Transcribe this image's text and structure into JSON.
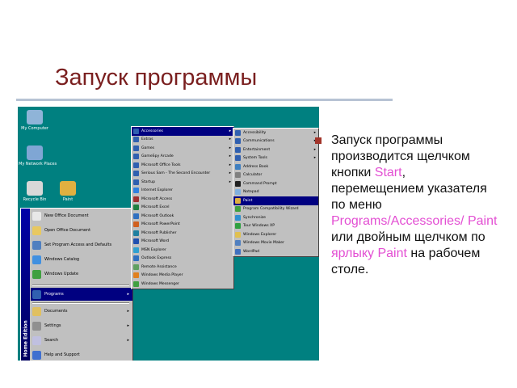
{
  "slide": {
    "title": "Запуск программы",
    "bullet_parts": [
      {
        "text": "Запуск программы производится щелчком кнопки ",
        "accent": false
      },
      {
        "text": "Start",
        "accent": true
      },
      {
        "text": ", перемещением указателя по меню ",
        "accent": false
      },
      {
        "text": "Programs/Accessories/ Paint",
        "accent": true
      },
      {
        "text": " или двойным щелчком по ",
        "accent": false
      },
      {
        "text": "ярлыку Paint",
        "accent": true
      },
      {
        "text": " на рабочем столе.",
        "accent": false
      }
    ],
    "colors": {
      "title": "#7a1f1f",
      "accent": "#e34fd3",
      "bullet": "#a2342a",
      "rule": "#b7c3d4"
    }
  },
  "screenshot": {
    "desktop_icons": [
      {
        "label": "My Computer",
        "icon": "computer-icon",
        "color": "#8fb4d8"
      },
      {
        "label": "My Network Places",
        "icon": "network-icon",
        "color": "#7fa6d4"
      },
      {
        "label": "Recycle Bin",
        "icon": "recycle-bin-icon",
        "color": "#d8d8d8"
      },
      {
        "label": "Paint",
        "icon": "paint-icon",
        "color": "#e0b040"
      }
    ],
    "start_menu": {
      "band_text": "Home Edition",
      "items": [
        {
          "label": "New Office Document",
          "arrow": false,
          "selected": false,
          "color": "#e8e8e8"
        },
        {
          "label": "Open Office Document",
          "arrow": false,
          "selected": false,
          "color": "#e8c860"
        },
        {
          "label": "Set Program Access and Defaults",
          "arrow": false,
          "selected": false,
          "color": "#5080c0"
        },
        {
          "label": "Windows Catalog",
          "arrow": false,
          "selected": false,
          "color": "#4090e0"
        },
        {
          "label": "Windows Update",
          "arrow": false,
          "selected": false,
          "color": "#40a040"
        },
        {
          "label": "Programs",
          "arrow": true,
          "selected": true,
          "color": "#3060b0"
        },
        {
          "label": "Documents",
          "arrow": true,
          "selected": false,
          "color": "#e0c060"
        },
        {
          "label": "Settings",
          "arrow": true,
          "selected": false,
          "color": "#909090"
        },
        {
          "label": "Search",
          "arrow": true,
          "selected": false,
          "color": "#c0c0e0"
        },
        {
          "label": "Help and Support",
          "arrow": false,
          "selected": false,
          "color": "#4070d0"
        }
      ]
    },
    "programs_menu": [
      {
        "label": "Accessories",
        "arrow": true,
        "selected": true,
        "color": "#3060b0"
      },
      {
        "label": "Extras",
        "arrow": true,
        "selected": false,
        "color": "#3060b0"
      },
      {
        "label": "Games",
        "arrow": true,
        "selected": false,
        "color": "#3060b0"
      },
      {
        "label": "GameSpy Arcade",
        "arrow": true,
        "selected": false,
        "color": "#3060b0"
      },
      {
        "label": "Microsoft Office Tools",
        "arrow": true,
        "selected": false,
        "color": "#3060b0"
      },
      {
        "label": "Serious Sam - The Second Encounter",
        "arrow": true,
        "selected": false,
        "color": "#3060b0"
      },
      {
        "label": "Startup",
        "arrow": true,
        "selected": false,
        "color": "#3060b0"
      },
      {
        "label": "Internet Explorer",
        "arrow": false,
        "selected": false,
        "color": "#3080e0"
      },
      {
        "label": "Microsoft Access",
        "arrow": false,
        "selected": false,
        "color": "#a03030"
      },
      {
        "label": "Microsoft Excel",
        "arrow": false,
        "selected": false,
        "color": "#208040"
      },
      {
        "label": "Microsoft Outlook",
        "arrow": false,
        "selected": false,
        "color": "#3070c0"
      },
      {
        "label": "Microsoft PowerPoint",
        "arrow": false,
        "selected": false,
        "color": "#d06020"
      },
      {
        "label": "Microsoft Publisher",
        "arrow": false,
        "selected": false,
        "color": "#2080a0"
      },
      {
        "label": "Microsoft Word",
        "arrow": false,
        "selected": false,
        "color": "#2050b0"
      },
      {
        "label": "MSN Explorer",
        "arrow": false,
        "selected": false,
        "color": "#30a0d0"
      },
      {
        "label": "Outlook Express",
        "arrow": false,
        "selected": false,
        "color": "#3070c0"
      },
      {
        "label": "Remote Assistance",
        "arrow": false,
        "selected": false,
        "color": "#60a060"
      },
      {
        "label": "Windows Media Player",
        "arrow": false,
        "selected": false,
        "color": "#e08020"
      },
      {
        "label": "Windows Messenger",
        "arrow": false,
        "selected": false,
        "color": "#40a040"
      }
    ],
    "accessories_menu": [
      {
        "label": "Accessibility",
        "arrow": true,
        "selected": false,
        "color": "#3060b0"
      },
      {
        "label": "Communications",
        "arrow": true,
        "selected": false,
        "color": "#3060b0"
      },
      {
        "label": "Entertainment",
        "arrow": true,
        "selected": false,
        "color": "#3060b0"
      },
      {
        "label": "System Tools",
        "arrow": true,
        "selected": false,
        "color": "#3060b0"
      },
      {
        "label": "Address Book",
        "arrow": false,
        "selected": false,
        "color": "#4080c0"
      },
      {
        "label": "Calculator",
        "arrow": false,
        "selected": false,
        "color": "#808080"
      },
      {
        "label": "Command Prompt",
        "arrow": false,
        "selected": false,
        "color": "#202020"
      },
      {
        "label": "Notepad",
        "arrow": false,
        "selected": false,
        "color": "#80b0e0"
      },
      {
        "label": "Paint",
        "arrow": false,
        "selected": true,
        "color": "#e0b040"
      },
      {
        "label": "Program Compatibility Wizard",
        "arrow": false,
        "selected": false,
        "color": "#40a040"
      },
      {
        "label": "Synchronize",
        "arrow": false,
        "selected": false,
        "color": "#3090d0"
      },
      {
        "label": "Tour Windows XP",
        "arrow": false,
        "selected": false,
        "color": "#30a040"
      },
      {
        "label": "Windows Explorer",
        "arrow": false,
        "selected": false,
        "color": "#e0c050"
      },
      {
        "label": "Windows Movie Maker",
        "arrow": false,
        "selected": false,
        "color": "#5080c0"
      },
      {
        "label": "WordPad",
        "arrow": false,
        "selected": false,
        "color": "#4070c0"
      }
    ]
  }
}
